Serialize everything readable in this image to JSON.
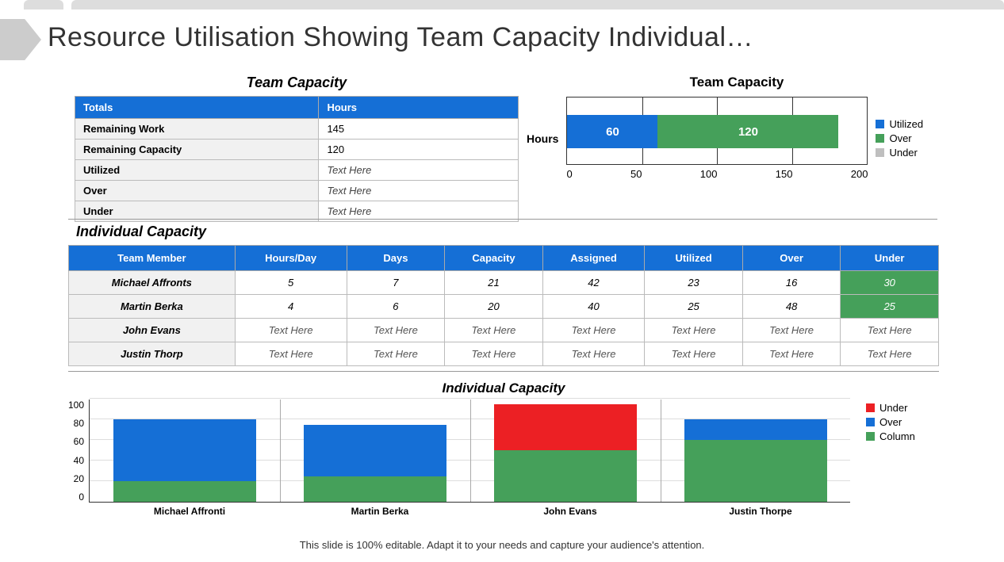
{
  "title": "Resource Utilisation Showing Team Capacity Individual…",
  "team_capacity": {
    "title": "Team Capacity",
    "headers": {
      "totals": "Totals",
      "hours": "Hours"
    },
    "rows": [
      {
        "label": "Remaining Work",
        "value": "145"
      },
      {
        "label": "Remaining Capacity",
        "value": "120"
      },
      {
        "label": "Utilized",
        "value": "Text Here"
      },
      {
        "label": "Over",
        "value": "Text Here"
      },
      {
        "label": "Under",
        "value": "Text Here"
      }
    ]
  },
  "team_chart": {
    "title": "Team Capacity",
    "ylabel": "Hours",
    "legend": [
      {
        "name": "Utilized",
        "color": "#156fd6"
      },
      {
        "name": "Over",
        "color": "#45a05a"
      },
      {
        "name": "Under",
        "color": "#bfbfbf"
      }
    ],
    "ticks": [
      "0",
      "50",
      "100",
      "150",
      "200"
    ]
  },
  "individual": {
    "title": "Individual Capacity",
    "headers": [
      "Team Member",
      "Hours/Day",
      "Days",
      "Capacity",
      "Assigned",
      "Utilized",
      "Over",
      "Under"
    ],
    "rows": [
      {
        "name": "Michael Affronts",
        "cells": [
          "5",
          "7",
          "21",
          "42",
          "23",
          "16"
        ],
        "under": "30",
        "under_green": true
      },
      {
        "name": "Martin Berka",
        "cells": [
          "4",
          "6",
          "20",
          "40",
          "25",
          "48"
        ],
        "under": "25",
        "under_green": true
      },
      {
        "name": "John Evans",
        "cells": [
          "Text Here",
          "Text Here",
          "Text Here",
          "Text Here",
          "Text Here",
          "Text Here"
        ],
        "under": "Text Here",
        "under_green": false
      },
      {
        "name": "Justin Thorp",
        "cells": [
          "Text Here",
          "Text Here",
          "Text Here",
          "Text Here",
          "Text Here",
          "Text Here"
        ],
        "under": "Text Here",
        "under_green": false
      }
    ]
  },
  "indiv_chart": {
    "title": "Individual Capacity",
    "legend": [
      {
        "name": "Under",
        "color": "#ec2024"
      },
      {
        "name": "Over",
        "color": "#156fd6"
      },
      {
        "name": "Column",
        "color": "#45a05a"
      }
    ],
    "yticks": [
      "100",
      "80",
      "60",
      "40",
      "20",
      "0"
    ],
    "xlabels": [
      "Michael Affronti",
      "Martin Berka",
      "John Evans",
      "Justin Thorpe"
    ]
  },
  "chart_data": [
    {
      "type": "bar",
      "orientation": "horizontal-stacked",
      "title": "Team Capacity",
      "ylabel": "Hours",
      "categories": [
        "Hours"
      ],
      "series": [
        {
          "name": "Utilized",
          "values": [
            60
          ],
          "color": "#156fd6"
        },
        {
          "name": "Over",
          "values": [
            120
          ],
          "color": "#45a05a"
        },
        {
          "name": "Under",
          "values": [
            0
          ],
          "color": "#bfbfbf"
        }
      ],
      "xlim": [
        0,
        200
      ]
    },
    {
      "type": "bar",
      "orientation": "vertical-stacked",
      "title": "Individual Capacity",
      "categories": [
        "Michael Affronti",
        "Martin Berka",
        "John Evans",
        "Justin Thorpe"
      ],
      "series": [
        {
          "name": "Column",
          "values": [
            20,
            25,
            50,
            60
          ],
          "color": "#45a05a"
        },
        {
          "name": "Over",
          "values": [
            60,
            50,
            0,
            20
          ],
          "color": "#156fd6"
        },
        {
          "name": "Under",
          "values": [
            0,
            0,
            45,
            0
          ],
          "color": "#ec2024"
        }
      ],
      "ylim": [
        0,
        100
      ]
    }
  ],
  "footer": "This slide is 100% editable. Adapt it to your needs and capture your audience's attention."
}
